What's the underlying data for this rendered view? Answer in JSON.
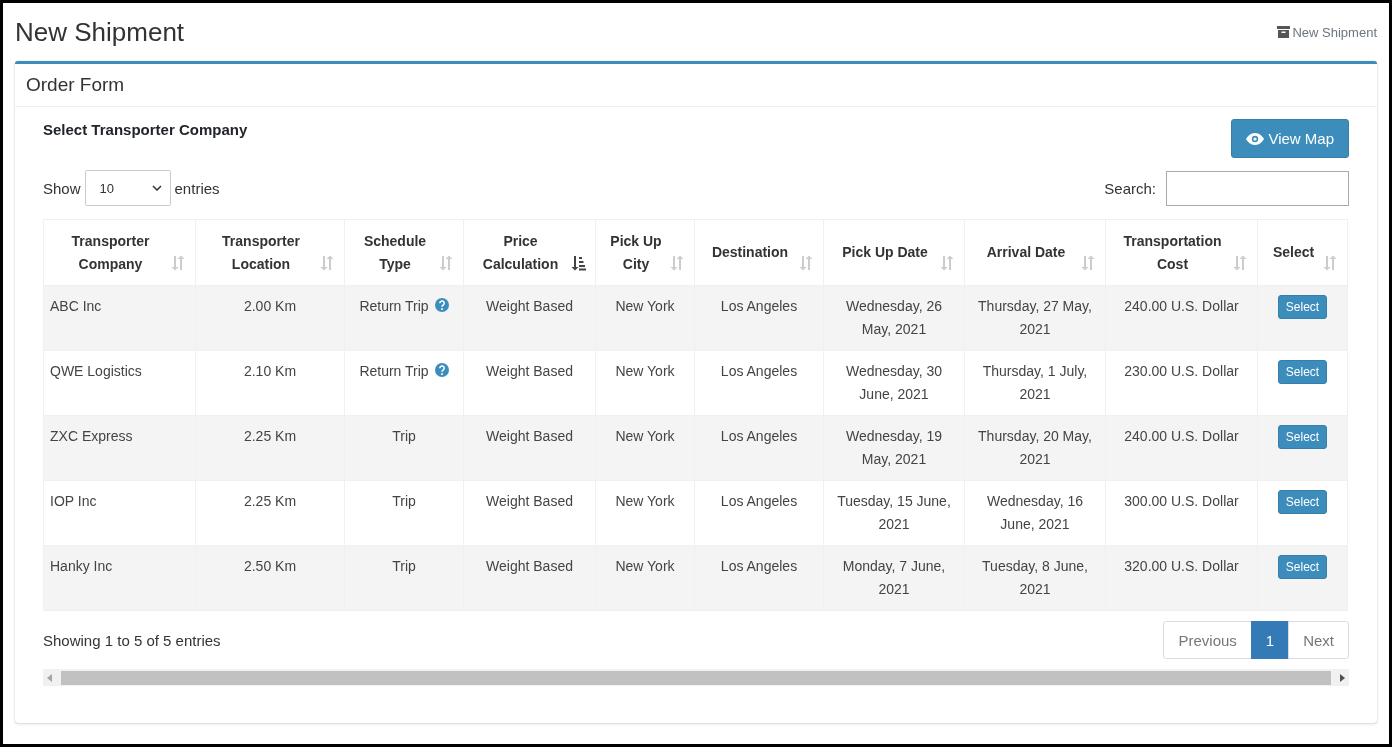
{
  "page_title": "New Shipment",
  "breadcrumb": "New Shipment",
  "card": {
    "title": "Order Form"
  },
  "section_title": "Select Transporter Company",
  "view_map_button": "View Map",
  "length": {
    "before": "Show",
    "value": "10",
    "after": "entries"
  },
  "search": {
    "label": "Search:"
  },
  "table": {
    "columns": [
      {
        "label": "Transporter Company",
        "sorted": false
      },
      {
        "label": "Transporter Location",
        "sorted": false
      },
      {
        "label": "Schedule Type",
        "sorted": false
      },
      {
        "label": "Price Calculation",
        "sorted": true
      },
      {
        "label": "Pick Up City",
        "sorted": false
      },
      {
        "label": "Destination",
        "sorted": false
      },
      {
        "label": "Pick Up Date",
        "sorted": false
      },
      {
        "label": "Arrival Date",
        "sorted": false
      },
      {
        "label": "Transportation Cost",
        "sorted": false
      },
      {
        "label": "Select",
        "sorted": false
      }
    ],
    "rows": [
      {
        "company": "ABC Inc",
        "location": "2.00 Km",
        "schedule": "Return Trip",
        "info": true,
        "price": "Weight Based",
        "city": "New York",
        "destination": "Los Angeles",
        "pickup": "Wednesday, 26 May, 2021",
        "arrival": "Thursday, 27 May, 2021",
        "cost": "240.00 U.S. Dollar",
        "button": "Select"
      },
      {
        "company": "QWE Logistics",
        "location": "2.10 Km",
        "schedule": "Return Trip",
        "info": true,
        "price": "Weight Based",
        "city": "New York",
        "destination": "Los Angeles",
        "pickup": "Wednesday, 30 June, 2021",
        "arrival": "Thursday, 1 July, 2021",
        "cost": "230.00 U.S. Dollar",
        "button": "Select"
      },
      {
        "company": "ZXC Express",
        "location": "2.25 Km",
        "schedule": "Trip",
        "info": false,
        "price": "Weight Based",
        "city": "New York",
        "destination": "Los Angeles",
        "pickup": "Wednesday, 19 May, 2021",
        "arrival": "Thursday, 20 May, 2021",
        "cost": "240.00 U.S. Dollar",
        "button": "Select"
      },
      {
        "company": "IOP Inc",
        "location": "2.25 Km",
        "schedule": "Trip",
        "info": false,
        "price": "Weight Based",
        "city": "New York",
        "destination": "Los Angeles",
        "pickup": "Tuesday, 15 June, 2021",
        "arrival": "Wednesday, 16 June, 2021",
        "cost": "300.00 U.S. Dollar",
        "button": "Select"
      },
      {
        "company": "Hanky Inc",
        "location": "2.50 Km",
        "schedule": "Trip",
        "info": false,
        "price": "Weight Based",
        "city": "New York",
        "destination": "Los Angeles",
        "pickup": "Monday, 7 June, 2021",
        "arrival": "Tuesday, 8 June, 2021",
        "cost": "320.00 U.S. Dollar",
        "button": "Select"
      }
    ]
  },
  "info_text": "Showing 1 to 5 of 5 entries",
  "pagination": [
    {
      "label": "Previous",
      "selected": false
    },
    {
      "label": "1",
      "selected": true
    },
    {
      "label": "Next",
      "selected": false
    }
  ]
}
